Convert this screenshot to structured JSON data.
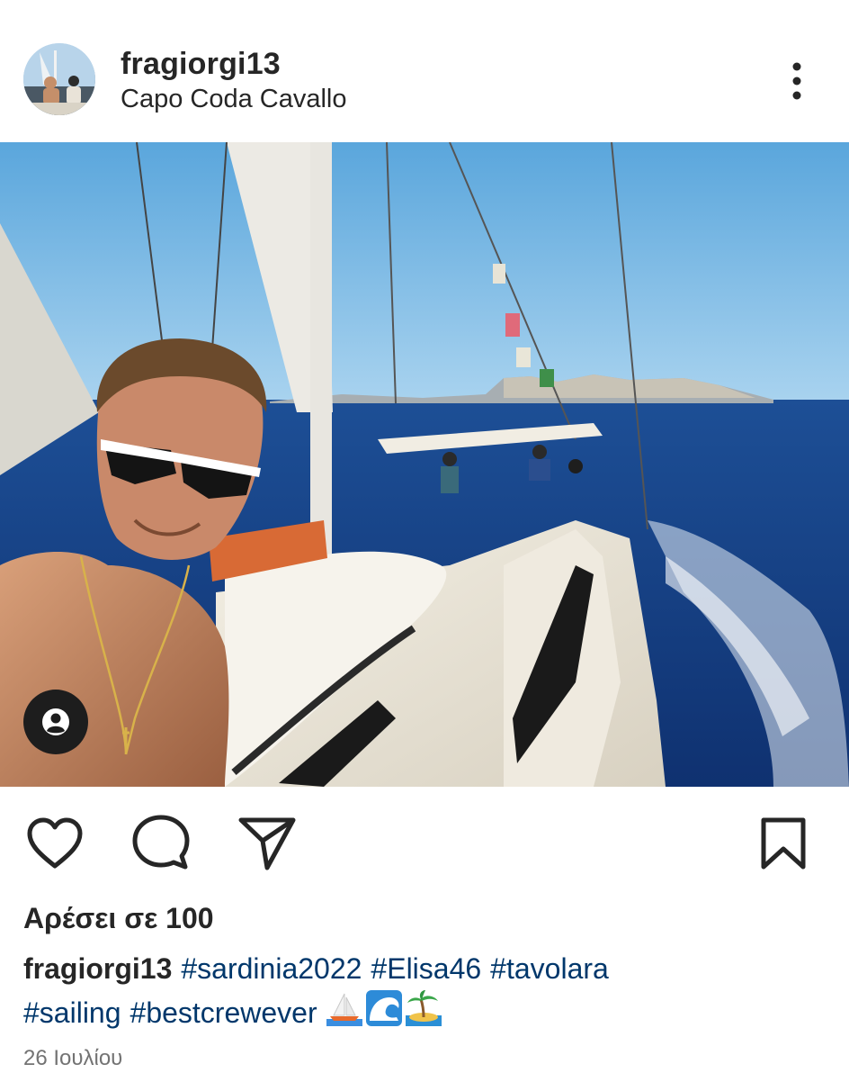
{
  "post": {
    "username": "fragiorgi13",
    "location": "Capo Coda Cavallo",
    "likes_label": "Αρέσει σε 100",
    "caption": {
      "username": "fragiorgi13",
      "hashtags": [
        "#sardinia2022",
        "#Elisa46",
        "#tavolara",
        "#sailing",
        "#bestcrewever"
      ],
      "emojis": [
        "sailboat-emoji",
        "wave-emoji",
        "island-emoji"
      ]
    },
    "date": "26 Ιουλίου"
  },
  "icons": {
    "more": "more-options-icon",
    "tag": "user-tag-icon",
    "like": "heart-icon",
    "comment": "comment-icon",
    "share": "send-icon",
    "save": "bookmark-icon"
  },
  "colors": {
    "text": "#262626",
    "hashtag": "#00376b",
    "muted": "#737373",
    "sky": "#7ab8e6",
    "sea": "#173f82"
  }
}
